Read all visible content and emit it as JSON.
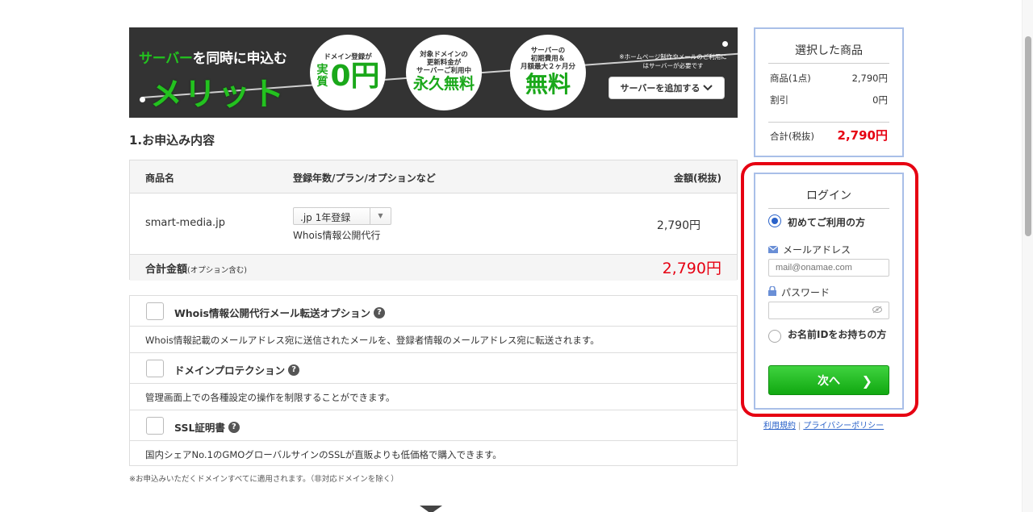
{
  "banner": {
    "tagline_green": "サーバー",
    "tagline_rest": "を同時に申込む",
    "headline": "メリット",
    "circle1": {
      "small": "ドメイン登録が",
      "big_prefix": "実質",
      "big": "0円"
    },
    "circle2": {
      "small1": "対象ドメインの",
      "small2": "更新料金が",
      "small3": "サーバーご利用中",
      "big": "永久無料"
    },
    "circle3": {
      "small1": "サーバーの",
      "small2": "初期費用＆",
      "small3": "月額最大２ヶ月分",
      "big": "無料"
    },
    "note": "※ホームページ制作やメールのご利用にはサーバーが必要です",
    "add_button": "サーバーを追加する"
  },
  "section_title": "1.お申込み内容",
  "order_table": {
    "headers": {
      "product": "商品名",
      "detail": "登録年数/プラン/オプションなど",
      "price": "金額(税抜)"
    },
    "row": {
      "domain": "smart-media.jp",
      "select_value": ".jp 1年登録",
      "sub": "Whois情報公開代行",
      "price": "2,790円"
    },
    "total": {
      "label": "合計金額",
      "label_small": "(オプション含む)",
      "value": "2,790円"
    }
  },
  "options": [
    {
      "title": "Whois情報公開代行メール転送オプション",
      "desc": "Whois情報記載のメールアドレス宛に送信されたメールを、登録者情報のメールアドレス宛に転送されます。"
    },
    {
      "title": "ドメインプロテクション",
      "desc": "管理画面上での各種設定の操作を制限することができます。"
    },
    {
      "title": "SSL証明書",
      "desc": "国内シェアNo.1のGMOグローバルサインのSSLが直販よりも低価格で購入できます。"
    }
  ],
  "footnote": "※お申込みいただくドメインすべてに適用されます。（非対応ドメインを除く）",
  "summary": {
    "title": "選択した商品",
    "items_label": "商品(1点)",
    "items_value": "2,790円",
    "discount_label": "割引",
    "discount_value": "0円",
    "total_label": "合計(税抜)",
    "total_value": "2,790円"
  },
  "login": {
    "title": "ログイン",
    "option_new": "初めてご利用の方",
    "email_label": "メールアドレス",
    "email_placeholder": "mail@onamae.com",
    "password_label": "パスワード",
    "option_existing": "お名前IDをお持ちの方",
    "next_button": "次へ"
  },
  "links": {
    "terms": "利用規約",
    "privacy": "プライバシーポリシー"
  },
  "colors": {
    "accent_green": "#23c21f",
    "price_red": "#e60012",
    "link_blue": "#2a62c9",
    "panel_border": "#a9bfe8"
  }
}
